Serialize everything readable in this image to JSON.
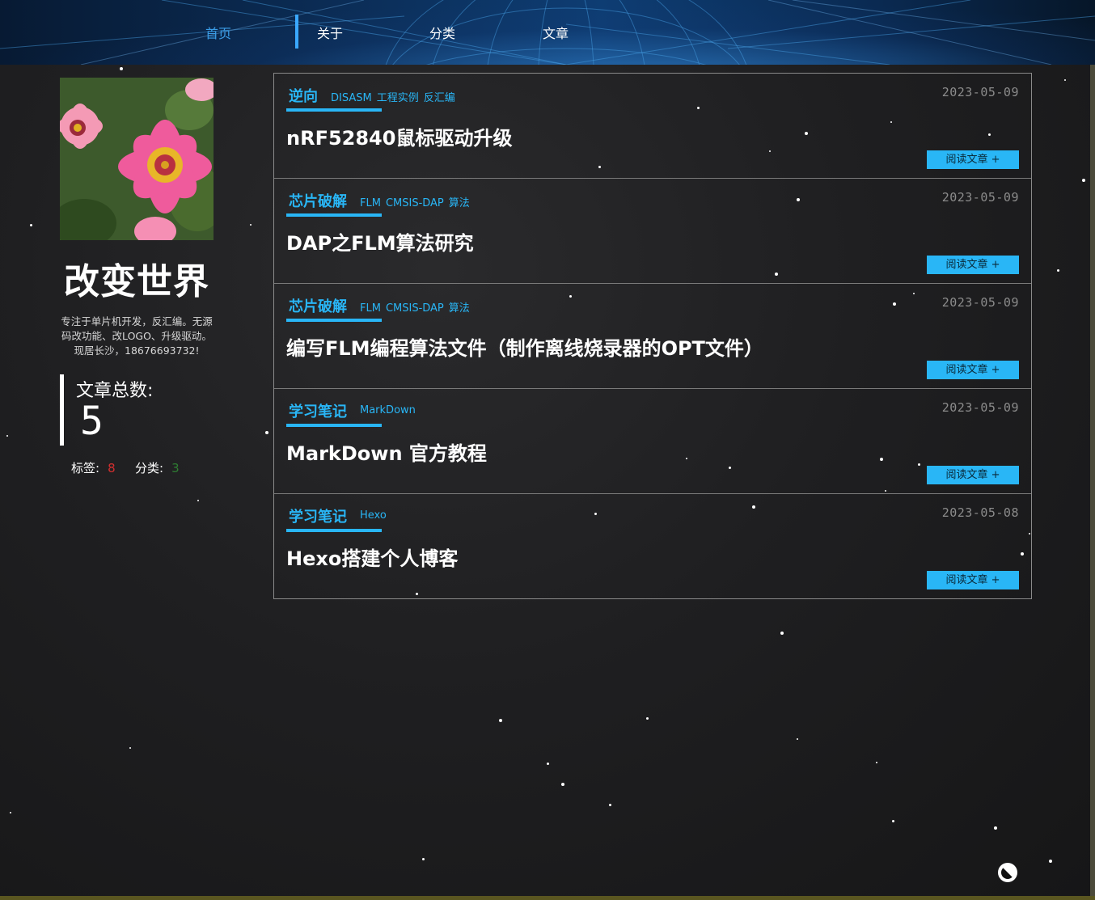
{
  "nav": {
    "items": [
      {
        "label": "首页"
      },
      {
        "label": "关于"
      },
      {
        "label": "分类"
      },
      {
        "label": "文章"
      }
    ]
  },
  "sidebar": {
    "title": "改变世界",
    "description": "专注于单片机开发，反汇编。无源码改功能、改LOGO、升级驱动。现居长沙，18676693732!",
    "post_count_label": "文章总数:",
    "post_count": "5",
    "tags_label": "标签:",
    "tags_count": "8",
    "categories_label": "分类:",
    "categories_count": "3"
  },
  "posts": [
    {
      "category": "逆向",
      "tags": [
        "DISASM",
        "工程实例",
        "反汇编"
      ],
      "date": "2023-05-09",
      "title": "nRF52840鼠标驱动升级",
      "read_label": "阅读文章 +"
    },
    {
      "category": "芯片破解",
      "tags": [
        "FLM",
        "CMSIS-DAP",
        "算法"
      ],
      "date": "2023-05-09",
      "title": "DAP之FLM算法研究",
      "read_label": "阅读文章 +"
    },
    {
      "category": "芯片破解",
      "tags": [
        "FLM",
        "CMSIS-DAP",
        "算法"
      ],
      "date": "2023-05-09",
      "title": "编写FLM编程算法文件（制作离线烧录器的OPT文件）",
      "read_label": "阅读文章 +"
    },
    {
      "category": "学习笔记",
      "tags": [
        "MarkDown"
      ],
      "date": "2023-05-09",
      "title": "MarkDown 官方教程",
      "read_label": "阅读文章 +"
    },
    {
      "category": "学习笔记",
      "tags": [
        "Hexo"
      ],
      "date": "2023-05-08",
      "title": "Hexo搭建个人博客",
      "read_label": "阅读文章 +"
    }
  ],
  "colors": {
    "accent": "#29b6f6",
    "nav_active": "#3b9ee8",
    "tags_count": "#d32f2f",
    "categories_count": "#2e7d32"
  }
}
